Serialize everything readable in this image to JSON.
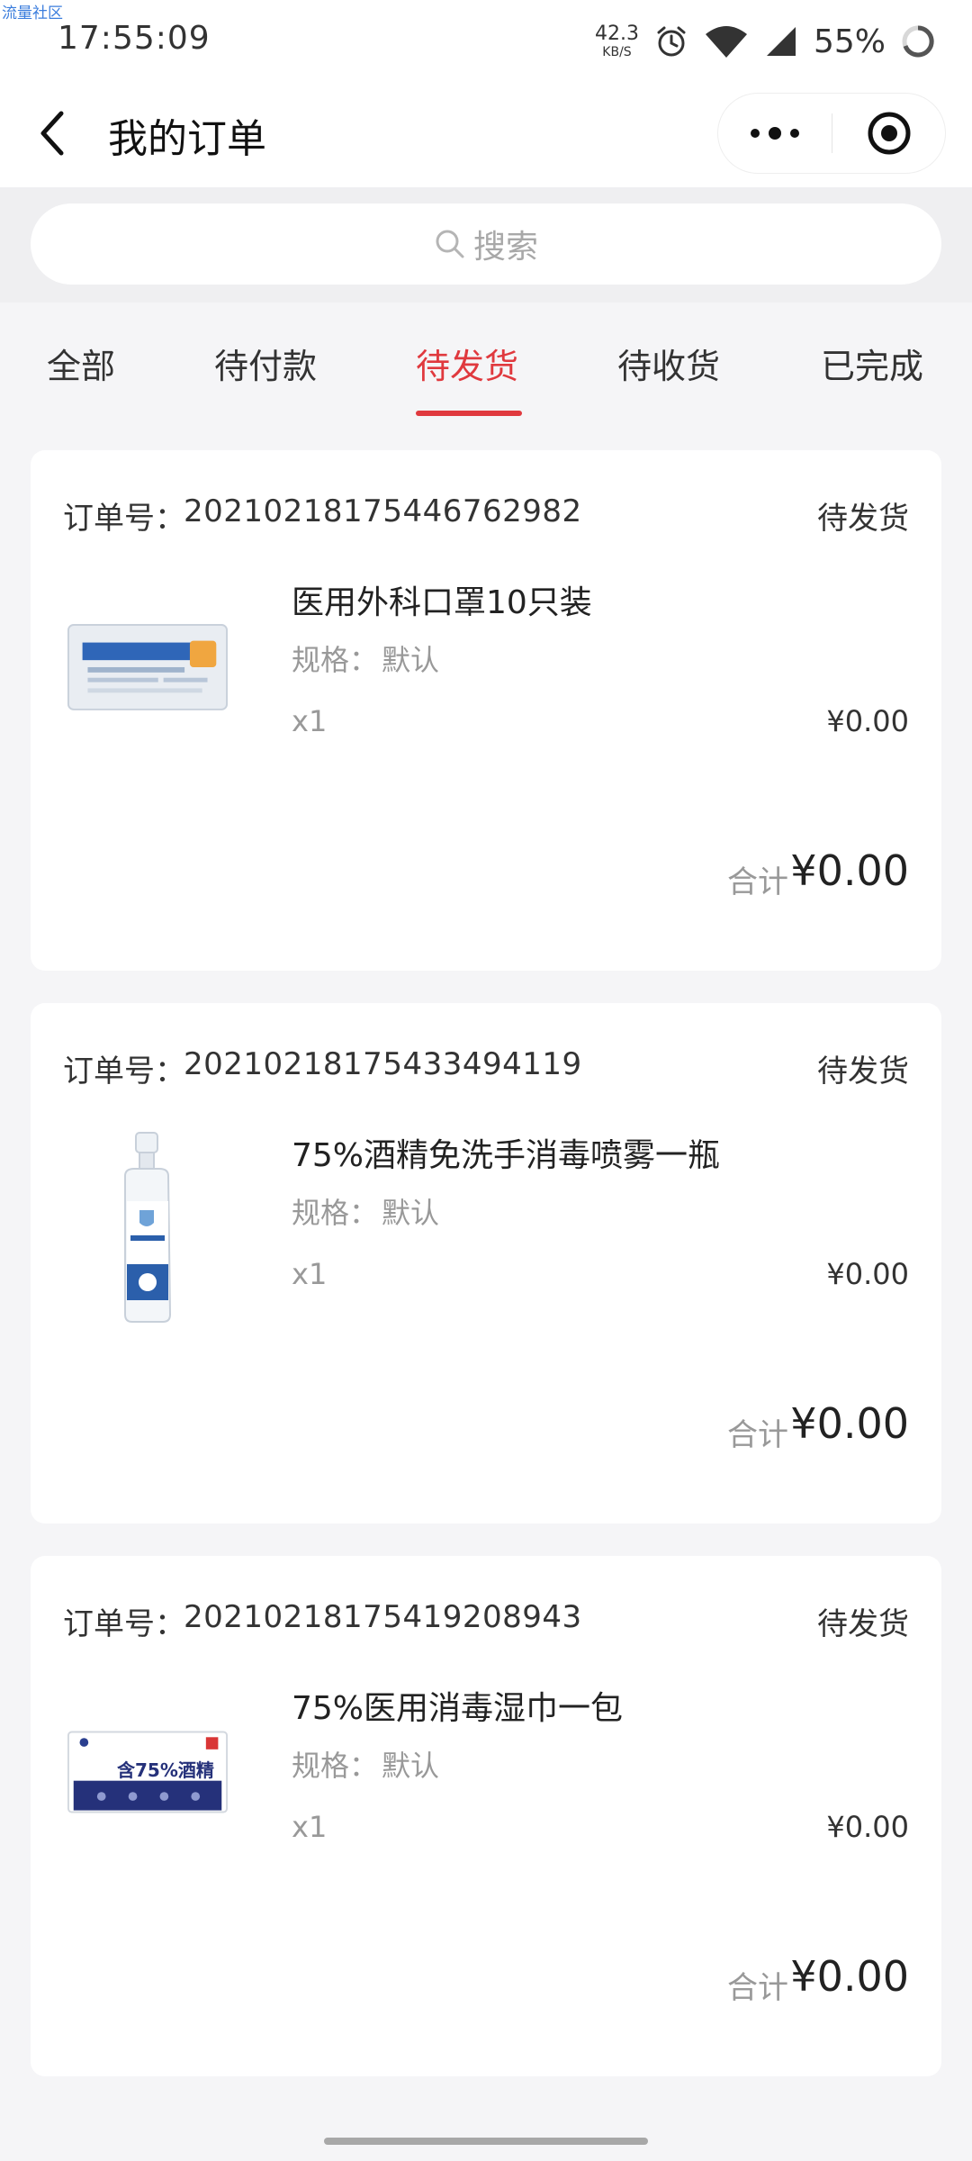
{
  "status_bar": {
    "watermark": "流量社区",
    "time": "17:55:09",
    "net_speed_value": "42.3",
    "net_speed_unit": "KB/S",
    "battery": "55%",
    "icons": [
      "alarm-icon",
      "wifi-icon",
      "signal-icon",
      "battery-ring-icon"
    ]
  },
  "header": {
    "title": "我的订单",
    "back_icon": "chevron-left-icon",
    "more_icon": "more-dots-icon",
    "close_icon": "target-circle-icon"
  },
  "search": {
    "placeholder": "搜索",
    "icon": "search-icon"
  },
  "tabs": [
    {
      "label": "全部",
      "active": false
    },
    {
      "label": "待付款",
      "active": false
    },
    {
      "label": "待发货",
      "active": true
    },
    {
      "label": "待收货",
      "active": false
    },
    {
      "label": "已完成",
      "active": false
    }
  ],
  "accent_color": "#e0393e",
  "orders": [
    {
      "order_no_label": "订单号：",
      "order_no": "20210218175446762982",
      "status": "待发货",
      "product_name": "医用外科口罩10只装",
      "spec_label": "规格：",
      "spec_value": "默认",
      "quantity": "x1",
      "unit_price": "¥0.00",
      "total_label": "合计",
      "total": "¥0.00",
      "image": "mask-package-image"
    },
    {
      "order_no_label": "订单号：",
      "order_no": "20210218175433494119",
      "status": "待发货",
      "product_name": "75%酒精免洗手消毒喷雾一瓶",
      "spec_label": "规格：",
      "spec_value": "默认",
      "quantity": "x1",
      "unit_price": "¥0.00",
      "total_label": "合计",
      "total": "¥0.00",
      "image": "spray-bottle-image"
    },
    {
      "order_no_label": "订单号：",
      "order_no": "20210218175419208943",
      "status": "待发货",
      "product_name": "75%医用消毒湿巾一包",
      "spec_label": "规格：",
      "spec_value": "默认",
      "quantity": "x1",
      "unit_price": "¥0.00",
      "total_label": "合计",
      "total": "¥0.00",
      "image": "wipes-package-image",
      "image_text": "含75%酒精"
    }
  ]
}
